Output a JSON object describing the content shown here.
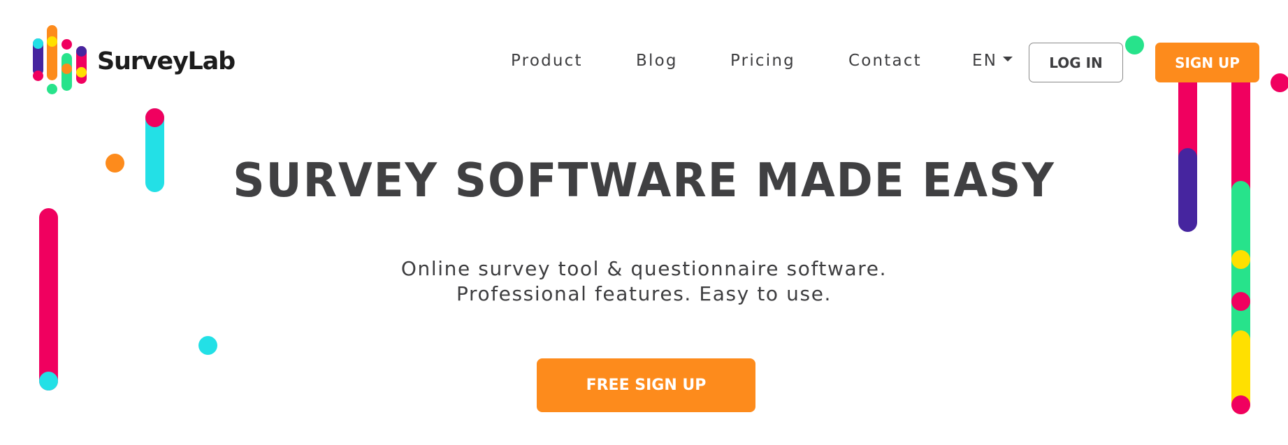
{
  "brand": {
    "name": "SurveyLab",
    "colors": {
      "orange": "#fd8b1c",
      "pink": "#f0005f",
      "cyan": "#23e0e6",
      "purple": "#46259f",
      "green": "#27e38b",
      "yellow": "#ffe000",
      "text": "#404042"
    }
  },
  "header": {
    "nav": [
      {
        "label": "Product"
      },
      {
        "label": "Blog"
      },
      {
        "label": "Pricing"
      },
      {
        "label": "Contact"
      }
    ],
    "language": {
      "selected": "EN",
      "icon": "caret-down-icon"
    },
    "login_label": "LOG IN",
    "signup_label": "SIGN UP"
  },
  "hero": {
    "title": "SURVEY SOFTWARE MADE EASY",
    "subtitle_lines": [
      "Online survey tool & questionnaire software.",
      "Professional features. Easy to use."
    ],
    "cta_label": "FREE SIGN UP"
  }
}
